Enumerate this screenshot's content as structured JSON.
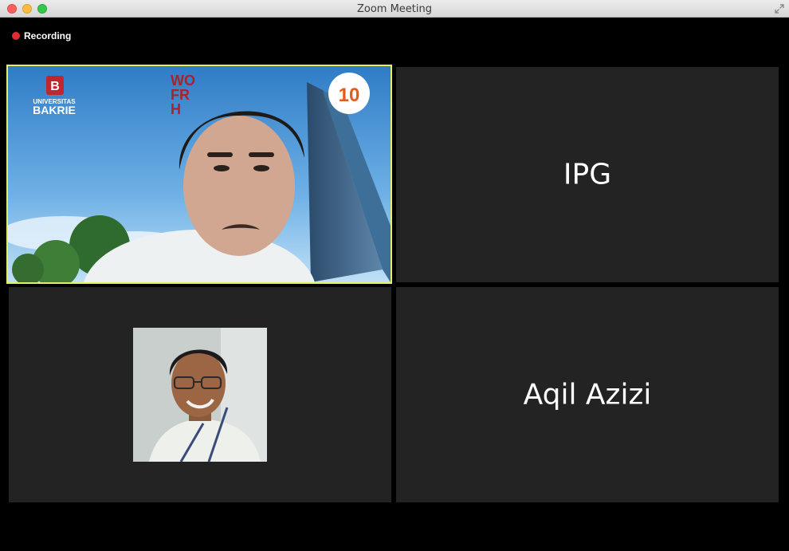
{
  "window": {
    "title": "Zoom Meeting"
  },
  "recording": {
    "label": "Recording"
  },
  "participants": [
    {
      "name": "",
      "video_on": true,
      "active_speaker": true,
      "background_text": {
        "brand_top": "UNIVERSITAS",
        "brand_bottom": "BAKRIE",
        "banner": [
          "WO",
          "FR",
          "H"
        ],
        "badge": "10"
      }
    },
    {
      "name": "IPG",
      "video_on": false
    },
    {
      "name": "",
      "video_on": false,
      "has_profile_photo": true
    },
    {
      "name": "Aqil Azizi",
      "video_on": false
    }
  ],
  "colors": {
    "active_speaker_border": "#e3ee6b",
    "recording_dot": "#e02b35",
    "tile_background": "#232323"
  }
}
